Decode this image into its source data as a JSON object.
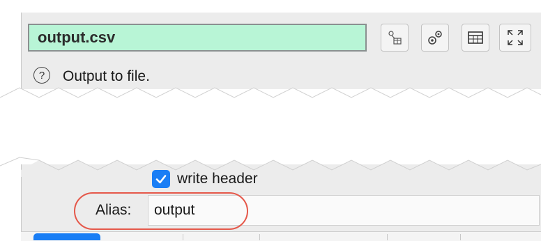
{
  "node": {
    "filename": "output.csv",
    "description": "Output to file."
  },
  "toolbar": {
    "buttons": [
      {
        "icon": "node-connection-icon"
      },
      {
        "icon": "settings-gears-icon"
      },
      {
        "icon": "table-view-icon"
      },
      {
        "icon": "expand-icon"
      }
    ]
  },
  "options": {
    "write_header_label": "write header",
    "write_header_checked": true,
    "alias_label": "Alias:",
    "alias_value": "output"
  },
  "colors": {
    "filename_bg": "#b8f5d6",
    "checkbox_accent": "#1a7ef5",
    "highlight_ring": "#e5584a"
  }
}
